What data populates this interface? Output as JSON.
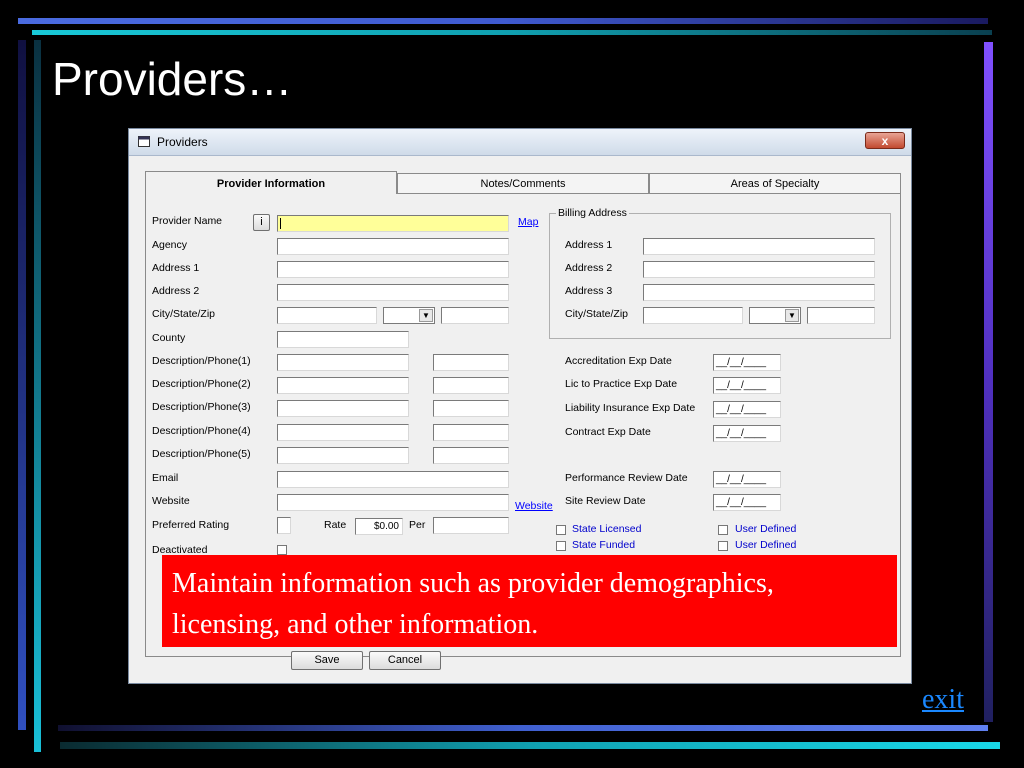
{
  "slide": {
    "title": "Providers…",
    "callout": "Maintain information such as provider demographics, licensing, and other information.",
    "exit_link": "exit"
  },
  "window": {
    "title": "Providers",
    "close_label": "x",
    "tabs": [
      "Provider Information",
      "Notes/Comments",
      "Areas of Specialty"
    ],
    "info_button": "i",
    "map_link": "Map",
    "website_link": "Website",
    "left_labels": {
      "provider_name": "Provider Name",
      "agency": "Agency",
      "address1": "Address 1",
      "address2": "Address 2",
      "city_state_zip": "City/State/Zip",
      "county": "County",
      "desc_phone_1": "Description/Phone(1)",
      "desc_phone_2": "Description/Phone(2)",
      "desc_phone_3": "Description/Phone(3)",
      "desc_phone_4": "Description/Phone(4)",
      "desc_phone_5": "Description/Phone(5)",
      "email": "Email",
      "website": "Website",
      "preferred_rating": "Preferred Rating",
      "deactivated": "Deactivated"
    },
    "rate_label": "Rate",
    "rate_value": "$0.00",
    "per_label": "Per",
    "billing": {
      "legend": "Billing Address",
      "address1": "Address 1",
      "address2": "Address 2",
      "address3": "Address 3",
      "city_state_zip": "City/State/Zip"
    },
    "dates": {
      "accreditation": "Accreditation Exp Date",
      "lic_practice": "Lic to Practice Exp Date",
      "liability": "Liability Insurance Exp Date",
      "contract": "Contract Exp Date",
      "performance": "Performance Review Date",
      "site_review": "Site Review Date",
      "placeholder": "__/__/____"
    },
    "checkboxes": {
      "state_licensed": "State Licensed",
      "state_funded": "State Funded",
      "user_defined_1": "User Defined",
      "user_defined_2": "User Defined"
    },
    "buttons": {
      "save": "Save",
      "cancel": "Cancel"
    }
  },
  "colors": {
    "highlight_field": "#ffff99",
    "callout_bg": "#ff0000",
    "link": "#0000ff"
  }
}
